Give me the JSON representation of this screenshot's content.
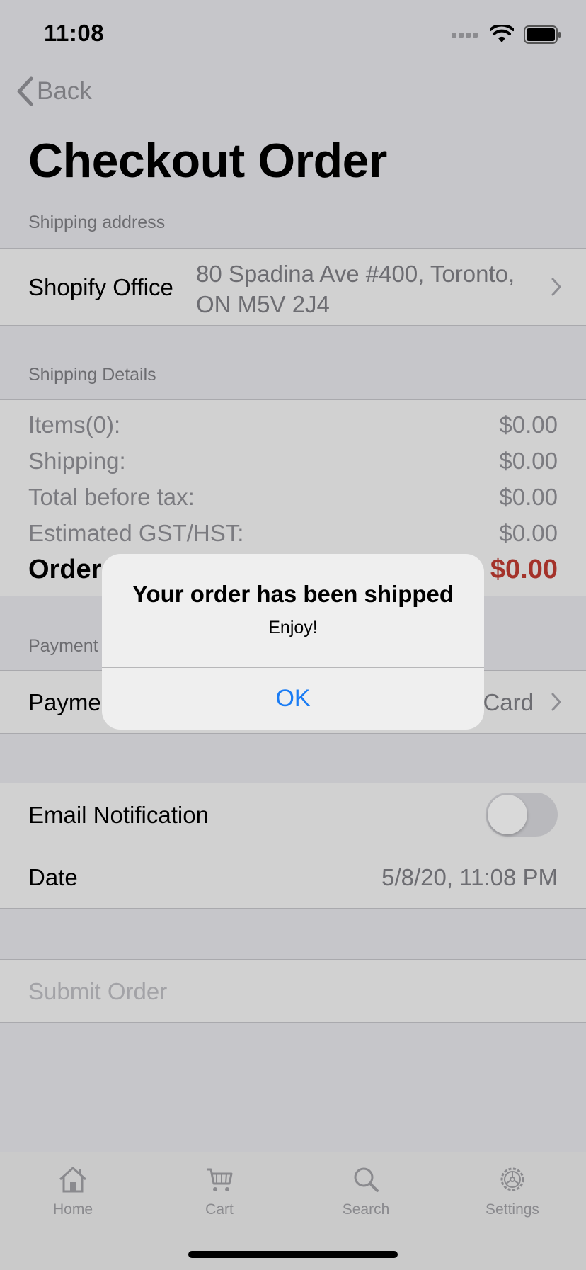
{
  "status_bar": {
    "time": "11:08"
  },
  "nav": {
    "back_label": "Back",
    "title": "Checkout Order"
  },
  "shipping_address": {
    "header": "Shipping address",
    "name": "Shopify Office",
    "address_line1": "80 Spadina Ave #400, Toronto,",
    "address_line2": "ON M5V 2J4"
  },
  "shipping_details": {
    "header": "Shipping Details",
    "rows": [
      {
        "label": "Items(0):",
        "value": "$0.00"
      },
      {
        "label": "Shipping:",
        "value": "$0.00"
      },
      {
        "label": "Total before tax:",
        "value": "$0.00"
      },
      {
        "label": "Estimated GST/HST:",
        "value": "$0.00"
      }
    ],
    "total_label": "Order",
    "total_value": "$0.00",
    "total_color": "#a4322a"
  },
  "payment": {
    "header": "Payment",
    "label": "Payme",
    "value": "Card"
  },
  "settings": {
    "email_label": "Email Notification",
    "email_enabled": false,
    "date_label": "Date",
    "date_value": "5/8/20, 11:08 PM"
  },
  "submit": {
    "label": "Submit Order"
  },
  "alert": {
    "title": "Your order has been shipped",
    "message": "Enjoy!",
    "button": "OK",
    "button_color": "#1a7cf4"
  },
  "tabs": [
    {
      "label": "Home",
      "icon": "home-icon"
    },
    {
      "label": "Cart",
      "icon": "cart-icon"
    },
    {
      "label": "Search",
      "icon": "search-icon"
    },
    {
      "label": "Settings",
      "icon": "gear-icon"
    }
  ]
}
